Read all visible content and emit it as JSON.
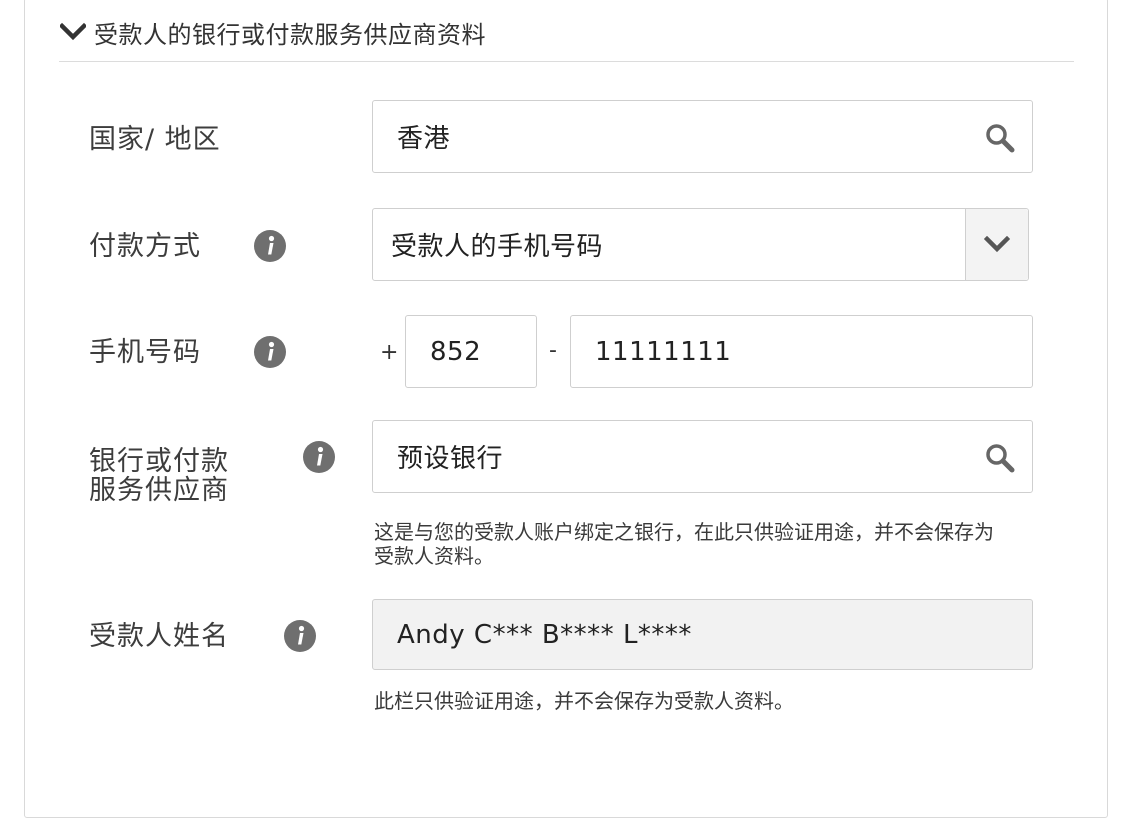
{
  "section": {
    "title": "受款人的银行或付款服务供应商资料"
  },
  "country": {
    "label": "国家/ 地区",
    "value": "香港"
  },
  "payment_method": {
    "label": "付款方式",
    "value": "受款人的手机号码"
  },
  "mobile": {
    "label": "手机号码",
    "plus": "+",
    "country_code": "852",
    "dash": "-",
    "number": "11111111"
  },
  "bank": {
    "label_line1": "银行或付款",
    "label_line2": "服务供应商",
    "value": "预设银行",
    "help_line1": "这是与您的受款人账户绑定之银行，在此只供验证用途，并不会保存为",
    "help_line2": "受款人资料。"
  },
  "payee_name": {
    "label": "受款人姓名",
    "value": "Andy C*** B**** L****",
    "help": "此栏只供验证用途，并不会保存为受款人资料。"
  },
  "icons": {
    "section_toggle": "chevron-down-icon",
    "info": "info-icon",
    "search": "search-icon",
    "dropdown": "chevron-down-icon"
  },
  "colors": {
    "info_icon": "#6f6f6f",
    "border": "#cfcfcf",
    "readonly_bg": "#f2f2f2"
  }
}
